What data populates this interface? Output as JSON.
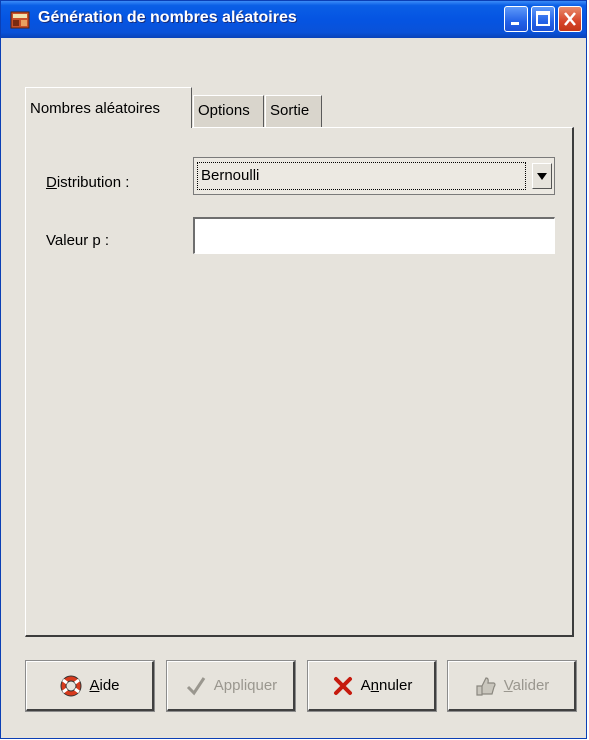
{
  "window": {
    "title": "Génération de nombres aléatoires"
  },
  "tabs": [
    {
      "label": "Nombres aléatoires",
      "active": true
    },
    {
      "label": "Options",
      "active": false
    },
    {
      "label": "Sortie",
      "active": false
    }
  ],
  "form": {
    "distribution": {
      "label_mnemonic": "D",
      "label_rest": "istribution :",
      "selected": "Bernoulli"
    },
    "p_value": {
      "label": "Valeur p :",
      "value": ""
    }
  },
  "buttons": {
    "aide": {
      "mnemonic": "A",
      "rest": "ide",
      "icon": "lifebuoy-icon",
      "enabled": true
    },
    "appliquer": {
      "mnemonic": "",
      "rest": "Appliquer",
      "icon": "checkmark-icon",
      "enabled": false
    },
    "annuler": {
      "pre": "A",
      "mnemonic": "n",
      "rest": "nuler",
      "icon": "red-x-icon",
      "enabled": true
    },
    "valider": {
      "mnemonic": "V",
      "rest": "alider",
      "icon": "thumbs-up-icon",
      "enabled": false
    }
  },
  "colors": {
    "titlebar": "#0554e2",
    "window_bg": "#e6e3dc",
    "close_button": "#d7452a"
  }
}
